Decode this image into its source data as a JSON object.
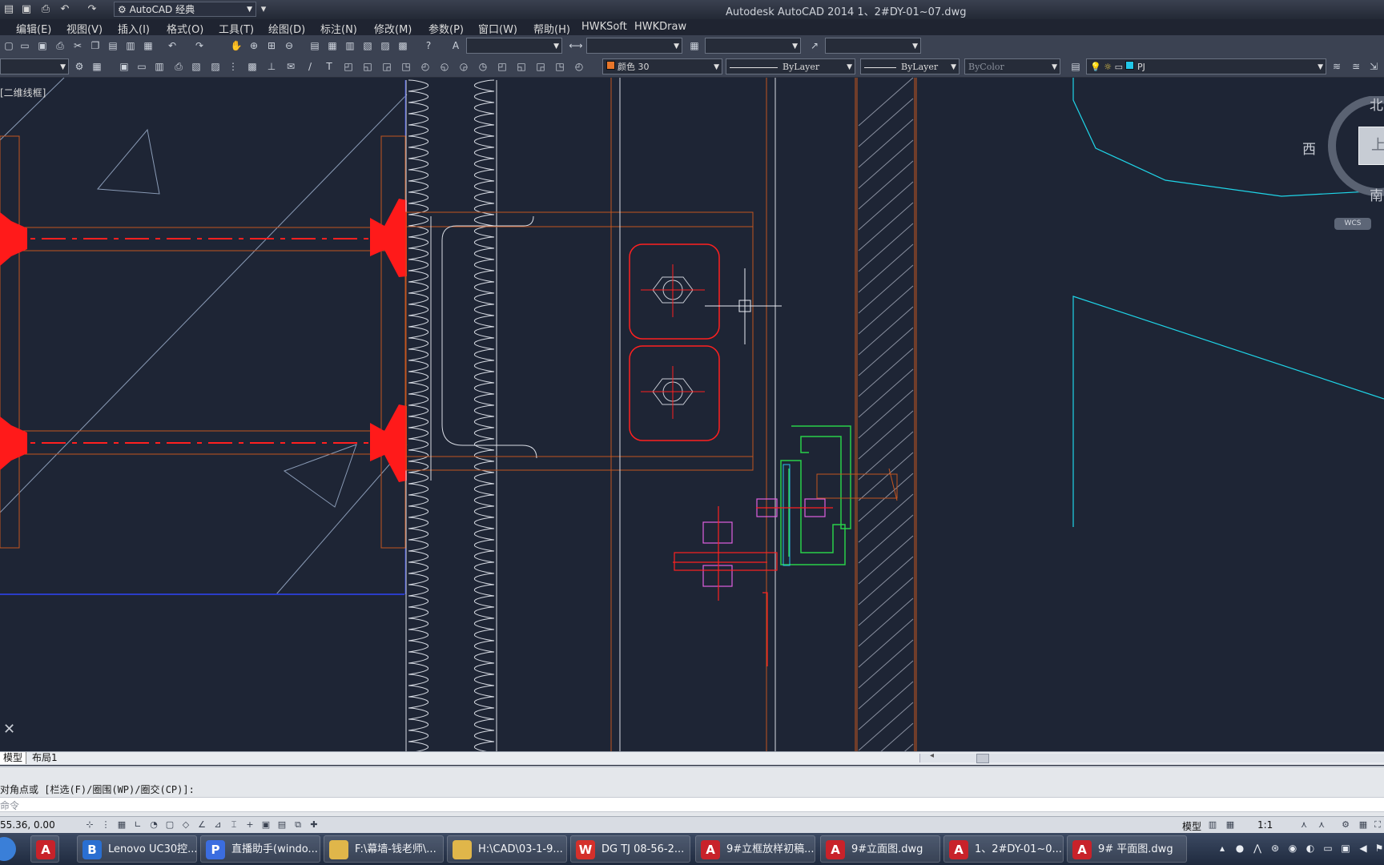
{
  "app": {
    "title": "Autodesk AutoCAD 2014    1、2#DY-01~07.dwg",
    "workspace": "AutoCAD 经典"
  },
  "menu": [
    "编辑(E)",
    "视图(V)",
    "插入(I)",
    "格式(O)",
    "工具(T)",
    "绘图(D)",
    "标注(N)",
    "修改(M)",
    "参数(P)",
    "窗口(W)",
    "帮助(H)",
    "HWKSoft",
    "HWKDraw"
  ],
  "properties": {
    "color": "颜色 30",
    "linetype": "ByLayer",
    "lineweight": "ByLayer",
    "plotstyle": "ByColor",
    "layer": "PJ"
  },
  "viewport": {
    "label": "[二维线框]"
  },
  "viewcube": {
    "north": "北",
    "west": "西",
    "south": "南",
    "face": "上",
    "wcs": "WCS"
  },
  "tabs": [
    "模型",
    "布局1"
  ],
  "command": {
    "history": "对角点或 [栏选(F)/圈围(WP)/圈交(CP)]:",
    "prompt": "命令"
  },
  "status": {
    "coords": "55.36, 0.00",
    "model": "模型",
    "scale": "1:1"
  },
  "taskbar": [
    {
      "label": "Lenovo UC30控...",
      "icon": "B",
      "color": "#2a6fd1"
    },
    {
      "label": "直播助手(windo...",
      "icon": "P",
      "color": "#3b6de0"
    },
    {
      "label": "F:\\幕墙-钱老师\\...",
      "icon": "",
      "color": "#e0b64a"
    },
    {
      "label": "H:\\CAD\\03-1-9...",
      "icon": "",
      "color": "#e0b64a"
    },
    {
      "label": "DG TJ 08-56-2...",
      "icon": "W",
      "color": "#d4302b"
    },
    {
      "label": "9#立框放样初稿...",
      "icon": "A",
      "color": "#c8222a"
    },
    {
      "label": "9#立面图.dwg",
      "icon": "A",
      "color": "#c8222a"
    },
    {
      "label": "1、2#DY-01~0...",
      "icon": "A",
      "color": "#c8222a"
    },
    {
      "label": "9# 平面图.dwg",
      "icon": "A",
      "color": "#c8222a"
    }
  ]
}
